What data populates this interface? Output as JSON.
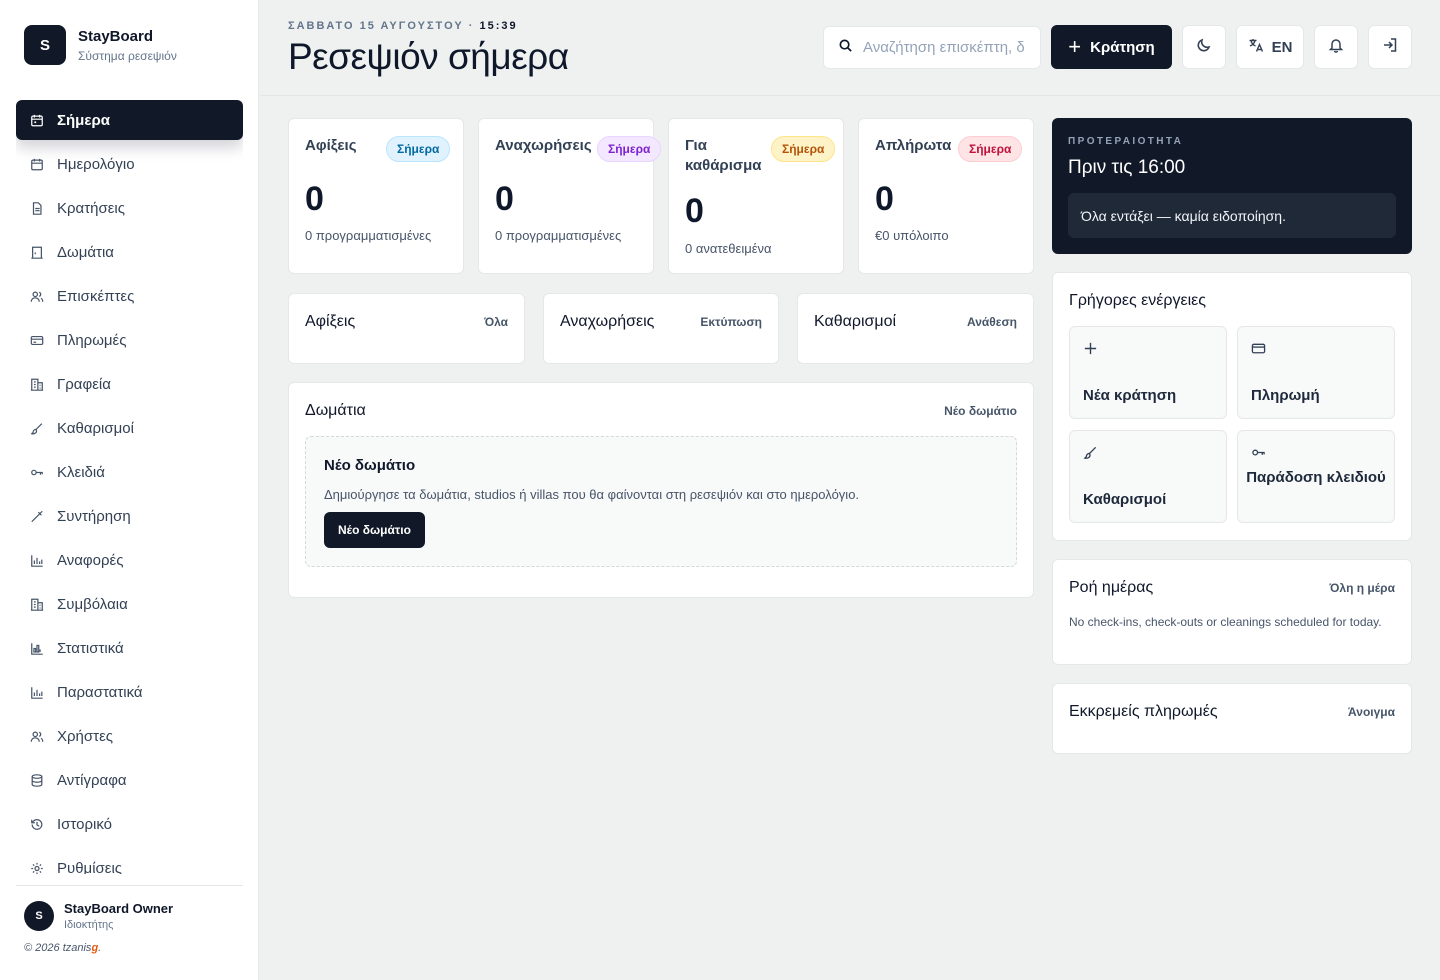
{
  "brand": {
    "initial": "S",
    "name": "StayBoard",
    "subtitle": "Σύστημα ρεσεψιόν"
  },
  "nav": [
    {
      "label": "Σήμερα",
      "icon": "calendar-today-icon",
      "active": true
    },
    {
      "label": "Ημερολόγιο",
      "icon": "calendar-icon"
    },
    {
      "label": "Κρατήσεις",
      "icon": "document-icon"
    },
    {
      "label": "Δωμάτια",
      "icon": "door-icon"
    },
    {
      "label": "Επισκέπτες",
      "icon": "users-icon"
    },
    {
      "label": "Πληρωμές",
      "icon": "credit-card-icon"
    },
    {
      "label": "Γραφεία",
      "icon": "building-icon"
    },
    {
      "label": "Καθαρισμοί",
      "icon": "brush-icon"
    },
    {
      "label": "Κλειδιά",
      "icon": "key-icon"
    },
    {
      "label": "Συντήρηση",
      "icon": "wrench-icon"
    },
    {
      "label": "Αναφορές",
      "icon": "bar-chart-icon"
    },
    {
      "label": "Συμβόλαια",
      "icon": "building-icon"
    },
    {
      "label": "Στατιστικά",
      "icon": "chart-icon"
    },
    {
      "label": "Παραστατικά",
      "icon": "bar-chart-icon"
    },
    {
      "label": "Χρήστες",
      "icon": "users-icon"
    },
    {
      "label": "Αντίγραφα",
      "icon": "database-icon"
    },
    {
      "label": "Ιστορικό",
      "icon": "history-icon"
    },
    {
      "label": "Ρυθμίσεις",
      "icon": "gear-icon"
    }
  ],
  "owner": {
    "initial": "S",
    "name": "StayBoard Owner",
    "role": "Ιδιοκτήτης"
  },
  "copyright": {
    "prefix": "© 2026 tzanis",
    "suffix": "g",
    "end": "."
  },
  "header": {
    "date": "ΣΑΒΒΑΤΟ 15 ΑΥΓΟΥΣΤΟΥ · ",
    "time": "15:39",
    "title": "Ρεσεψιόν σήμερα",
    "search_placeholder": "Αναζήτηση επισκέπτη, δ",
    "book_label": "Κράτηση",
    "lang_label": "EN"
  },
  "stats": [
    {
      "title": "Αφίξεις",
      "badge": "Σήμερα",
      "value": "0",
      "sub": "0 προγραμματισμένες"
    },
    {
      "title": "Αναχωρήσεις",
      "badge": "Σήμερα",
      "value": "0",
      "sub": "0 προγραμματισμένες"
    },
    {
      "title": "Για καθάρισμα",
      "badge": "Σήμερα",
      "value": "0",
      "sub": "0 ανατεθειμένα"
    },
    {
      "title": "Απλήρωτα",
      "badge": "Σήμερα",
      "value": "0",
      "sub": "€0 υπόλοιπο"
    }
  ],
  "lists": [
    {
      "title": "Αφίξεις",
      "link": "Όλα"
    },
    {
      "title": "Αναχωρήσεις",
      "link": "Εκτύπωση"
    },
    {
      "title": "Καθαρισμοί",
      "link": "Ανάθεση"
    }
  ],
  "rooms": {
    "title": "Δωμάτια",
    "link": "Νέο δωμάτιο",
    "empty_title": "Νέο δωμάτιο",
    "empty_desc": "Δημιούργησε τα δωμάτια, studios ή villas που θα φαίνονται στη ρεσεψιόν και στο ημερολόγιο.",
    "empty_button": "Νέο δωμάτιο"
  },
  "priority": {
    "label": "ΠΡΟΤΕΡΑΙΟΤΗΤΑ",
    "title": "Πριν τις 16:00",
    "message": "Όλα εντάξει — καμία ειδοποίηση."
  },
  "quick_actions": {
    "title": "Γρήγορες ενέργειες",
    "tiles": [
      {
        "label": "Νέα κράτηση",
        "icon": "plus-icon"
      },
      {
        "label": "Πληρωμή",
        "icon": "credit-card-icon"
      },
      {
        "label": "Καθαρισμοί",
        "icon": "brush-icon"
      },
      {
        "label": "Παράδοση κλειδιού",
        "icon": "key-icon"
      }
    ]
  },
  "day_flow": {
    "title": "Ροή ημέρας",
    "link": "Όλη η μέρα",
    "text": "No check-ins, check-outs or cleanings scheduled for today."
  },
  "pending": {
    "title": "Εκκρεμείς πληρωμές",
    "link": "Άνοιγμα"
  }
}
